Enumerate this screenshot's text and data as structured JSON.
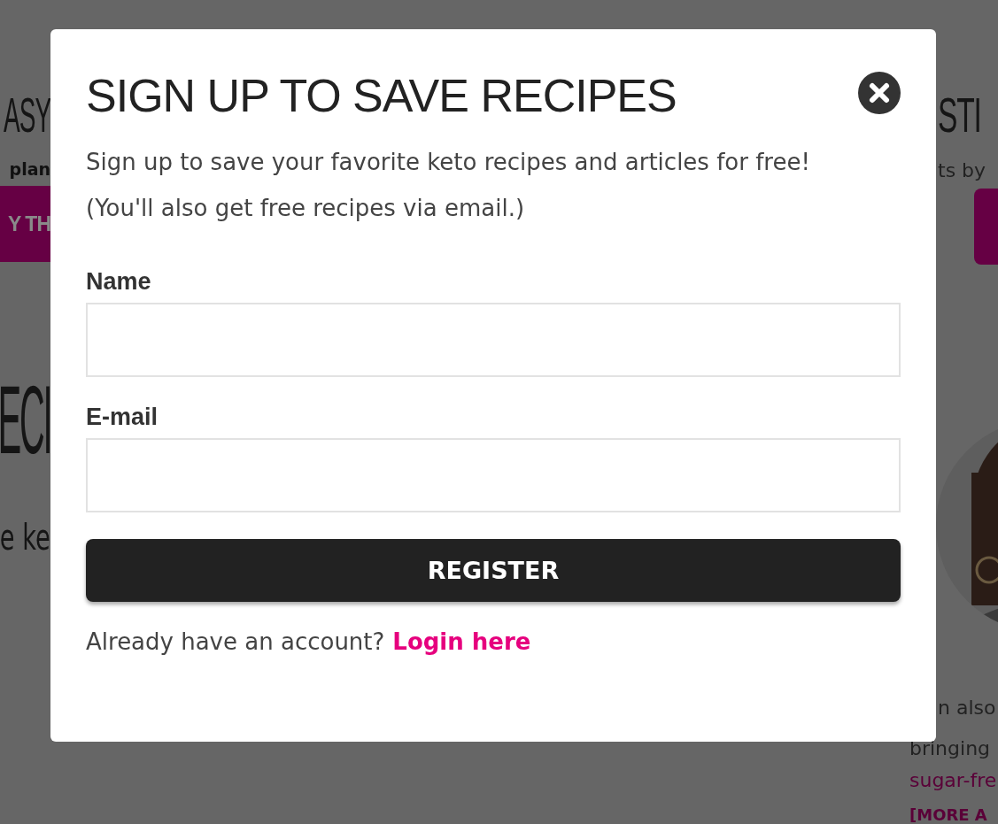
{
  "background": {
    "left": [
      {
        "kind": "heading",
        "text": "ASY"
      },
      {
        "kind": "text",
        "text": "plan"
      },
      {
        "kind": "button",
        "text": "Y TH"
      },
      {
        "kind": "big",
        "text": "ECI"
      },
      {
        "kind": "lead",
        "text": "e ke"
      }
    ],
    "right": [
      {
        "kind": "heading",
        "text": "STI"
      },
      {
        "kind": "text",
        "text": "ts by"
      },
      {
        "kind": "button"
      },
      {
        "kind": "picture"
      },
      {
        "kind": "body",
        "text": "n also"
      },
      {
        "kind": "body",
        "text": "bringing"
      },
      {
        "kind": "link",
        "text": "sugar-fre"
      },
      {
        "kind": "more",
        "text": "[MORE A"
      }
    ]
  },
  "modal": {
    "title": "SIGN UP TO SAVE RECIPES",
    "intro": [
      "Sign up to save your favorite keto recipes and articles for free!",
      "(You'll also get free recipes via email.)"
    ],
    "fields": [
      {
        "label": "Name"
      },
      {
        "label": "E-mail"
      }
    ],
    "button": "REGISTER",
    "footer": {
      "text": "Already have an account?",
      "link": "Login here"
    }
  }
}
